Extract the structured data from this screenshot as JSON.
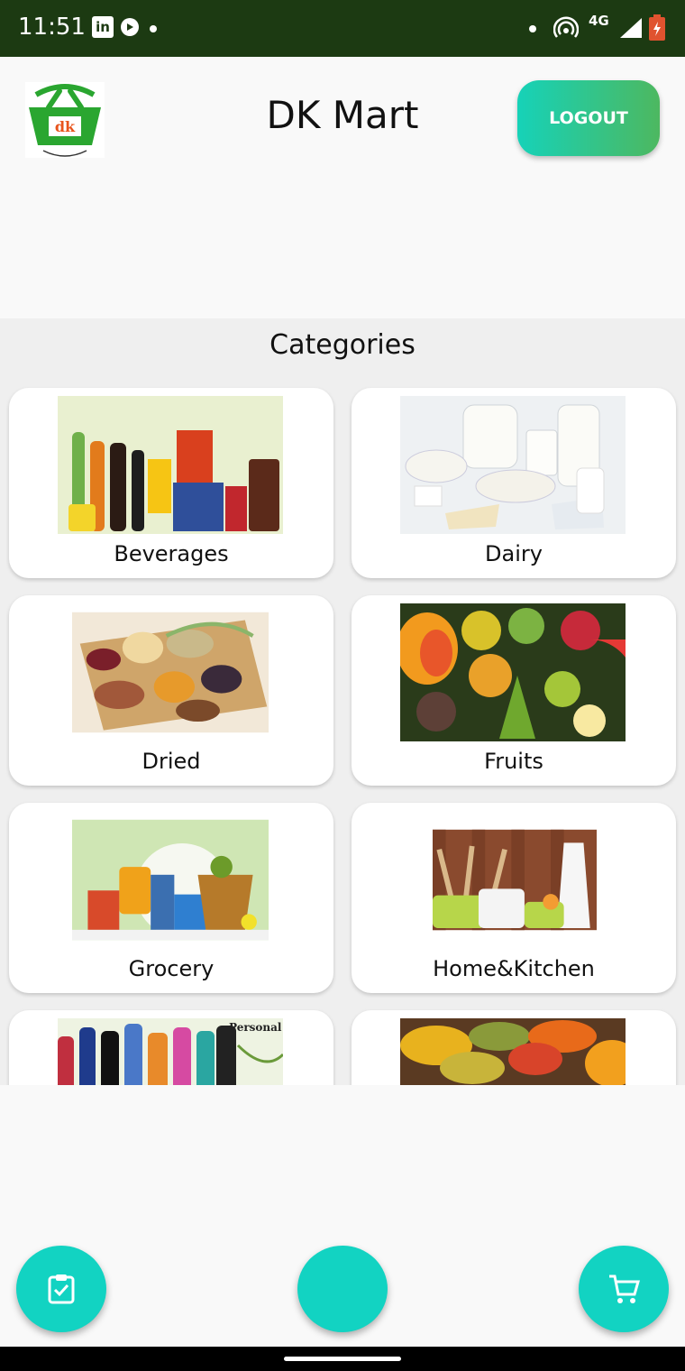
{
  "status_bar": {
    "time": "11:51",
    "network": "4G"
  },
  "header": {
    "logo_text": "dk",
    "title": "DK Mart",
    "logout_label": "LOGOUT"
  },
  "categories": {
    "heading": "Categories",
    "items": [
      {
        "label": "Beverages"
      },
      {
        "label": "Dairy"
      },
      {
        "label": "Dried"
      },
      {
        "label": "Fruits"
      },
      {
        "label": "Grocery"
      },
      {
        "label": "Home&Kitchen"
      },
      {
        "label": "",
        "image_caption": "Personal Care"
      },
      {
        "label": ""
      }
    ]
  },
  "fabs": {
    "orders_icon": "clipboard-check-icon",
    "center_icon": "none",
    "cart_icon": "shopping-cart-icon"
  },
  "colors": {
    "status_bar": "#1c3a12",
    "accent": "#12d3c2",
    "logout_gradient_start": "#16d2b8",
    "logout_gradient_end": "#4db860"
  }
}
